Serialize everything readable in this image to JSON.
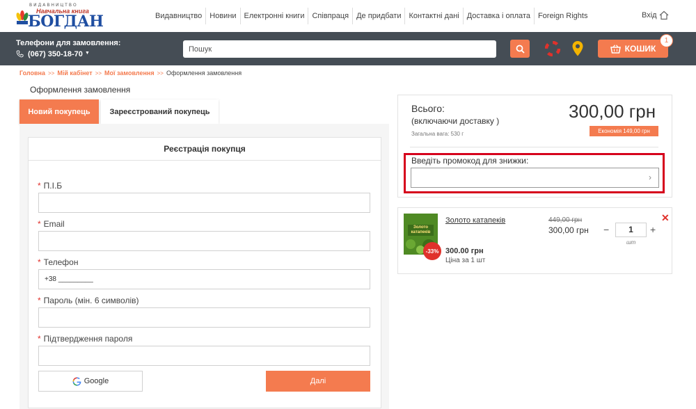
{
  "header": {
    "logo": {
      "small_text": "ВИДАВНИЦТВО",
      "sub_text": "Навчальна книга",
      "main_text": "БОГДАН"
    },
    "nav": [
      "Видавництво",
      "Новини",
      "Електронні книги",
      "Співпраця",
      "Де придбати",
      "Контактні дані",
      "Доставка і оплата",
      "Foreign Rights"
    ],
    "login_label": "Вхід"
  },
  "toolbar": {
    "phone_label": "Телефони для замовлення:",
    "phone_number": "(067) 350-18-70",
    "search_placeholder": "Пошук",
    "cart_label": "КОШИК",
    "cart_count": "1"
  },
  "breadcrumb": {
    "items": [
      "Головна",
      "Мій кабінет",
      "Мої замовлення"
    ],
    "separator": ">>",
    "current": "Оформлення замовлення"
  },
  "page_title": "Оформлення замовлення",
  "tabs": {
    "new_customer": "Новий покупець",
    "registered_customer": "Зареєстрований покупець"
  },
  "registration": {
    "title": "Реєстрація покупця",
    "fields": [
      {
        "label": "П.І.Б",
        "value": ""
      },
      {
        "label": "Email",
        "value": ""
      },
      {
        "label": "Телефон",
        "value": "+38 _________"
      },
      {
        "label": "Пароль (мін. 6 символів)",
        "value": ""
      },
      {
        "label": "Підтвердження пароля",
        "value": ""
      }
    ],
    "google_button": "Google",
    "next_button": "Далі"
  },
  "summary": {
    "total_label": "Всього:",
    "total_sub": "(включаючи доставку )",
    "weight": "Загальна вага: 530 г",
    "total_amount": "300,00 грн",
    "economy": "Економія 149,00 грн",
    "promo_label": "Введіть промокод для знижки:",
    "promo_value": ""
  },
  "item": {
    "cover_text": "Золото катапеків",
    "discount": "-33%",
    "title": "Золото катапеків",
    "old_price": "449,00 грн",
    "new_price": "300,00 грн",
    "quantity": "1",
    "unit": "шт",
    "sum": "300.00 грн",
    "unit_price": "Ціна за 1 шт"
  },
  "colors": {
    "accent": "#f47b4f",
    "toolbar_bg": "#454d55",
    "highlight": "#d6001c",
    "logo_blue": "#1f4ea1"
  }
}
